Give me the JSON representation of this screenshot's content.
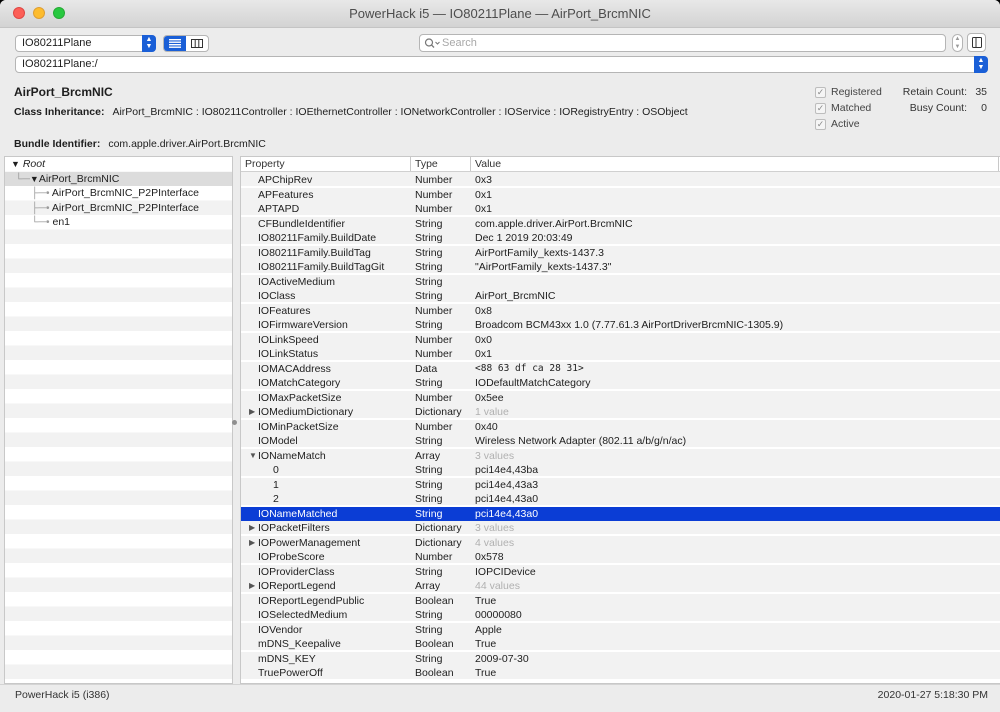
{
  "window": {
    "title": "PowerHack i5 — IO80211Plane — AirPort_BrcmNIC"
  },
  "toolbar": {
    "plane_select": "IO80211Plane",
    "search_placeholder": "Search",
    "path": "IO80211Plane:/"
  },
  "info": {
    "class_name": "AirPort_BrcmNIC",
    "inheritance_label": "Class Inheritance:",
    "inheritance_value": "AirPort_BrcmNIC : IO80211Controller : IOEthernetController : IONetworkController : IOService : IORegistryEntry : OSObject",
    "bundle_label": "Bundle Identifier:",
    "bundle_value": "com.apple.driver.AirPort.BrcmNIC",
    "checks": [
      {
        "label": "Registered",
        "checked": true
      },
      {
        "label": "Matched",
        "checked": true
      },
      {
        "label": "Active",
        "checked": true
      }
    ],
    "retain_label": "Retain Count:",
    "retain_value": "35",
    "busy_label": "Busy Count:",
    "busy_value": "0"
  },
  "tree": {
    "root": "Root",
    "node": "AirPort_BrcmNIC",
    "children": [
      "AirPort_BrcmNIC_P2PInterface",
      "AirPort_BrcmNIC_P2PInterface",
      "en1"
    ]
  },
  "table": {
    "headers": {
      "property": "Property",
      "type": "Type",
      "value": "Value"
    },
    "rows": [
      {
        "property": "APChipRev",
        "type": "Number",
        "value": "0x3"
      },
      {
        "property": "APFeatures",
        "type": "Number",
        "value": "0x1"
      },
      {
        "property": "APTAPD",
        "type": "Number",
        "value": "0x1"
      },
      {
        "property": "CFBundleIdentifier",
        "type": "String",
        "value": "com.apple.driver.AirPort.BrcmNIC"
      },
      {
        "property": "IO80211Family.BuildDate",
        "type": "String",
        "value": "Dec  1 2019 20:03:49"
      },
      {
        "property": "IO80211Family.BuildTag",
        "type": "String",
        "value": "AirPortFamily_kexts-1437.3"
      },
      {
        "property": "IO80211Family.BuildTagGit",
        "type": "String",
        "value": "\"AirPortFamily_kexts-1437.3\""
      },
      {
        "property": "IOActiveMedium",
        "type": "String",
        "value": ""
      },
      {
        "property": "IOClass",
        "type": "String",
        "value": "AirPort_BrcmNIC"
      },
      {
        "property": "IOFeatures",
        "type": "Number",
        "value": "0x8"
      },
      {
        "property": "IOFirmwareVersion",
        "type": "String",
        "value": "Broadcom BCM43xx 1.0 (7.77.61.3 AirPortDriverBrcmNIC-1305.9)"
      },
      {
        "property": "IOLinkSpeed",
        "type": "Number",
        "value": "0x0"
      },
      {
        "property": "IOLinkStatus",
        "type": "Number",
        "value": "0x1"
      },
      {
        "property": "IOMACAddress",
        "type": "Data",
        "value": "<88 63 df ca 28 31>"
      },
      {
        "property": "IOMatchCategory",
        "type": "String",
        "value": "IODefaultMatchCategory"
      },
      {
        "property": "IOMaxPacketSize",
        "type": "Number",
        "value": "0x5ee"
      },
      {
        "property": "IOMediumDictionary",
        "type": "Dictionary",
        "value": "1 value"
      },
      {
        "property": "IOMinPacketSize",
        "type": "Number",
        "value": "0x40"
      },
      {
        "property": "IOModel",
        "type": "String",
        "value": "Wireless Network Adapter (802.11 a/b/g/n/ac)"
      },
      {
        "property": "IONameMatch",
        "type": "Array",
        "value": "3 values"
      },
      {
        "property": "0",
        "type": "String",
        "value": "pci14e4,43ba"
      },
      {
        "property": "1",
        "type": "String",
        "value": "pci14e4,43a3"
      },
      {
        "property": "2",
        "type": "String",
        "value": "pci14e4,43a0"
      },
      {
        "property": "IONameMatched",
        "type": "String",
        "value": "pci14e4,43a0"
      },
      {
        "property": "IOPacketFilters",
        "type": "Dictionary",
        "value": "3 values"
      },
      {
        "property": "IOPowerManagement",
        "type": "Dictionary",
        "value": "4 values"
      },
      {
        "property": "IOProbeScore",
        "type": "Number",
        "value": "0x578"
      },
      {
        "property": "IOProviderClass",
        "type": "String",
        "value": "IOPCIDevice"
      },
      {
        "property": "IOReportLegend",
        "type": "Array",
        "value": "44 values"
      },
      {
        "property": "IOReportLegendPublic",
        "type": "Boolean",
        "value": "True"
      },
      {
        "property": "IOSelectedMedium",
        "type": "String",
        "value": "00000080"
      },
      {
        "property": "IOVendor",
        "type": "String",
        "value": "Apple"
      },
      {
        "property": "mDNS_Keepalive",
        "type": "Boolean",
        "value": "True"
      },
      {
        "property": "mDNS_KEY",
        "type": "String",
        "value": "2009-07-30"
      },
      {
        "property": "TruePowerOff",
        "type": "Boolean",
        "value": "True"
      }
    ]
  },
  "status": {
    "left": "PowerHack i5 (i386)",
    "right": "2020-01-27 5:18:30 PM"
  }
}
